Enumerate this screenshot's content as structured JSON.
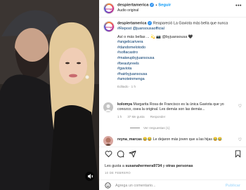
{
  "header": {
    "username": "despiertamerica",
    "audio": "Audio original",
    "follow_label": "Seguir"
  },
  "caption": {
    "username": "despiertamerica",
    "text": "Reapareció La Gaviota más bella que nunca",
    "repost": "#Repost @juansousaofficial",
    "body": "Así o más bellas ... 💫 📷 @byjuansousa 🖤",
    "hashtags": [
      "#angelicarivera",
      "#dandomelotodo",
      "#sofiacastro",
      "#makeupbyjuansousa",
      "#beautyreels",
      "#gaviota",
      "#hairbyjuansousa",
      "#amoteinmenga"
    ],
    "edited": "Editado · 1 h"
  },
  "comments": [
    {
      "username": "kolomya",
      "text": "Margarita Rosa de Francisco es la única Gaviota que yo conozco, osea la original. Les demás son las demás...",
      "time": "1 h",
      "likes": "37 Me gusta",
      "reply_label": "Responder"
    },
    {
      "username": "reyna_marcas",
      "text": "😂😂 Le dejaron más joven que a las hijas 😂😂",
      "time": "",
      "likes": "",
      "reply_label": ""
    }
  ],
  "replies_label": "Ver respuestas (1)",
  "likes": {
    "prefix": "Les gusta a",
    "user1": "susanahermera9734",
    "middle": "y",
    "others": "otras personas"
  },
  "date": "10 DE FEBRERO",
  "add_comment": {
    "placeholder": "Agrega un comentario...",
    "publish_label": "Publicar"
  },
  "colors": {
    "accent": "#0095f6",
    "hashtag": "#00376b",
    "muted": "#8e8e8e"
  }
}
